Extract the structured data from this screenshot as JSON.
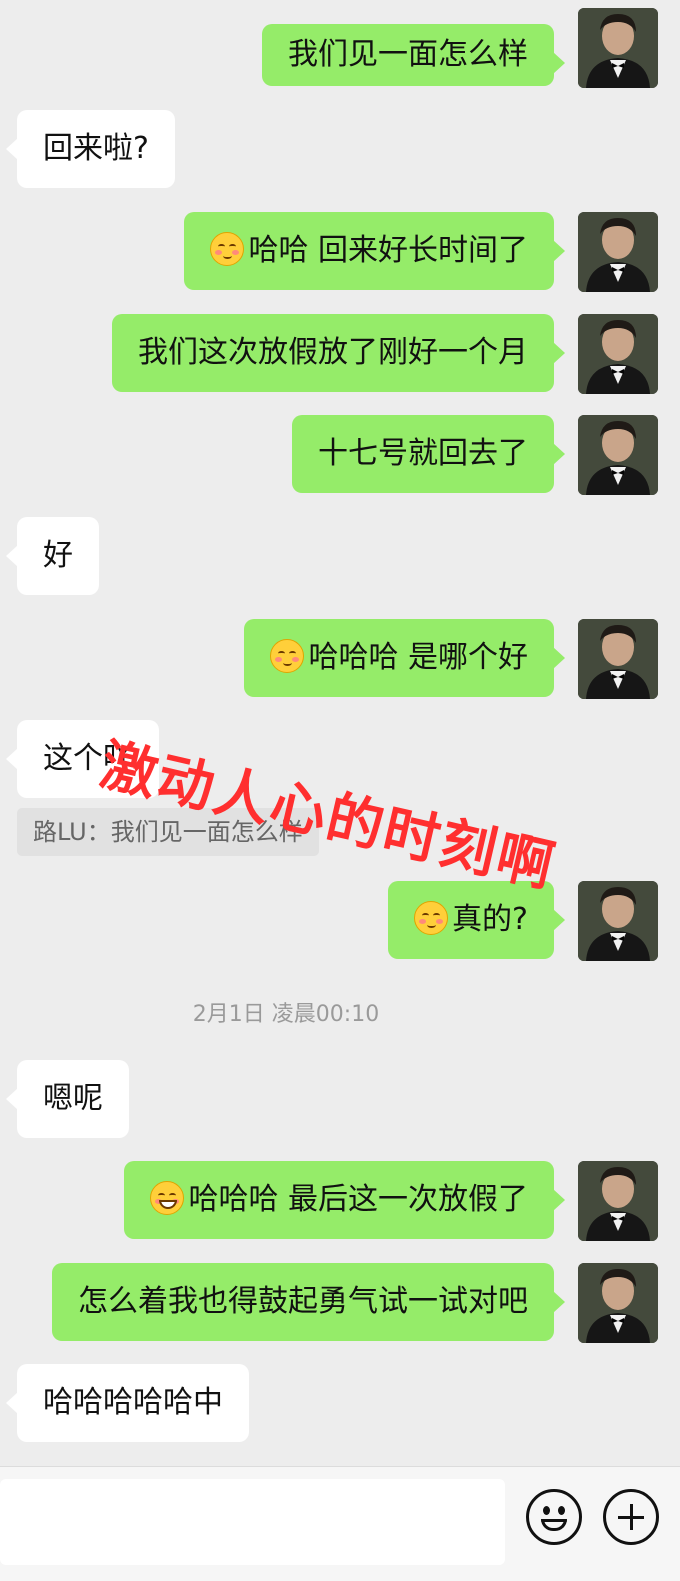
{
  "messages": [
    {
      "side": "me",
      "text": "我们见一面怎么样",
      "emoji": ""
    },
    {
      "side": "them",
      "text": "回来啦?",
      "emoji": ""
    },
    {
      "side": "me",
      "text": "哈哈   回来好长时间了",
      "emoji": "blush-emoji"
    },
    {
      "side": "me",
      "text": "我们这次放假放了刚好一个月",
      "emoji": ""
    },
    {
      "side": "me",
      "text": "十七号就回去了",
      "emoji": ""
    },
    {
      "side": "them",
      "text": "好",
      "emoji": ""
    },
    {
      "side": "me",
      "text": "哈哈哈   是哪个好",
      "emoji": "blush-emoji"
    },
    {
      "side": "them",
      "text": "这个吖",
      "emoji": ""
    },
    {
      "side": "me",
      "text": "真的?",
      "emoji": "blush-emoji"
    },
    {
      "side": "them",
      "text": "嗯呢",
      "emoji": ""
    },
    {
      "side": "me",
      "text": "哈哈哈   最后这一次放假了",
      "emoji": "grin-emoji"
    },
    {
      "side": "me",
      "text": "怎么着我也得鼓起勇气试一试对吧",
      "emoji": ""
    },
    {
      "side": "them",
      "text": "哈哈哈哈哈中",
      "emoji": ""
    }
  ],
  "quote": "路LU：我们见一面怎么样",
  "timestamp": "2月1日 凌晨00:10",
  "overlay_text": "激动人心的时刻啊",
  "colors": {
    "my_bubble": "#95ec69",
    "their_bubble": "#ffffff",
    "background": "#ededed",
    "overlay": "#ff2f2f"
  },
  "input_bar": {
    "emoji_button": "smiley-icon",
    "more_button": "plus-icon"
  }
}
